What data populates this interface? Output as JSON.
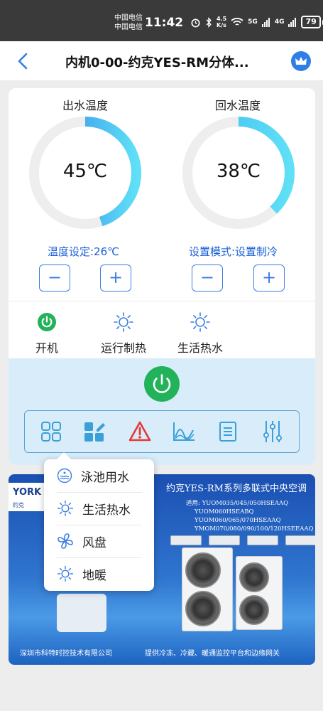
{
  "status_bar": {
    "carrier_1": "中国电信",
    "carrier_2": "中国电信",
    "time": "11:42",
    "net_speed_value": "4.5",
    "net_speed_unit": "K/s",
    "signal_1": "5G",
    "signal_2": "4G",
    "battery": "79"
  },
  "header": {
    "title": "内机0-00-约克YES-RM分体..."
  },
  "gauges": [
    {
      "title": "出水温度",
      "value": "45℃",
      "fill": 0.45
    },
    {
      "title": "回水温度",
      "value": "38℃",
      "fill": 0.38
    }
  ],
  "settings": {
    "temperature": "温度设定:26℃",
    "mode": "设置模式:设置制冷",
    "minus": "−",
    "plus": "+"
  },
  "status_items": [
    {
      "label": "开机",
      "icon": "power-icon"
    },
    {
      "label": "运行制热",
      "icon": "sun-icon"
    },
    {
      "label": "生活热水",
      "icon": "sun-icon"
    }
  ],
  "toolbar": {
    "items": [
      "grid-icon",
      "edit-grid-icon",
      "alarm-icon",
      "chart-icon",
      "list-icon",
      "sliders-icon"
    ]
  },
  "banner": {
    "logo": "YORK",
    "logo_sub": "约克",
    "title": "约克YES-RM系列多联式中央空调",
    "models": [
      "适用: YUOM035/045/050HSEAAQ",
      "YUOM060HSEABQ",
      "YUOM060/065/070HSEAAQ",
      "YMOM070/080/090/100/120HSEEAAQ"
    ],
    "footer_left": "深圳市科特时控技术有限公司",
    "footer_right": "提供冷冻、冷藏、暖通监控平台和边缘网关"
  },
  "popup": {
    "items": [
      {
        "label": "泳池用水",
        "icon": "pool-icon"
      },
      {
        "label": "生活热水",
        "icon": "sun-icon"
      },
      {
        "label": "风盘",
        "icon": "fan-icon"
      },
      {
        "label": "地暖",
        "icon": "sun-icon"
      }
    ]
  },
  "colors": {
    "accent_blue": "#1a5fd6",
    "gauge_cyan": "#4fd6f2",
    "gauge_track": "#eeeeee",
    "power_green": "#22b35a",
    "alarm_red": "#e53935",
    "panel_blue": "#d8ecfa"
  }
}
